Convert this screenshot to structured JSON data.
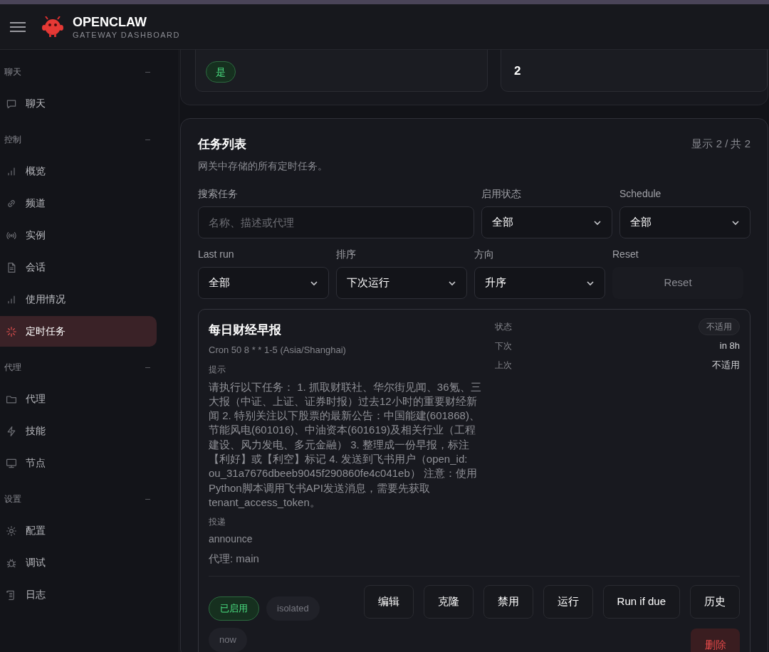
{
  "header": {
    "brand": "OPENCLAW",
    "subtitle": "GATEWAY DASHBOARD"
  },
  "sidebar": {
    "groups": [
      {
        "label": "聊天",
        "expanded": true,
        "items": [
          {
            "label": "聊天",
            "kind": "chat",
            "selected": false
          }
        ]
      },
      {
        "label": "控制",
        "expanded": true,
        "items": [
          {
            "label": "概览",
            "kind": "bars",
            "selected": false
          },
          {
            "label": "频道",
            "kind": "link",
            "selected": false
          },
          {
            "label": "实例",
            "kind": "radio",
            "selected": false
          },
          {
            "label": "会话",
            "kind": "doc",
            "selected": false
          },
          {
            "label": "使用情况",
            "kind": "bars",
            "selected": false
          },
          {
            "label": "定时任务",
            "kind": "spark",
            "selected": true
          }
        ]
      },
      {
        "label": "代理",
        "expanded": true,
        "items": [
          {
            "label": "代理",
            "kind": "folder",
            "selected": false
          },
          {
            "label": "技能",
            "kind": "bolt",
            "selected": false
          },
          {
            "label": "节点",
            "kind": "monitor",
            "selected": false
          }
        ]
      },
      {
        "label": "设置",
        "expanded": true,
        "items": [
          {
            "label": "配置",
            "kind": "gear",
            "selected": false
          },
          {
            "label": "调试",
            "kind": "bug",
            "selected": false
          },
          {
            "label": "日志",
            "kind": "scroll",
            "selected": false
          }
        ]
      }
    ]
  },
  "stats": [
    {
      "kind": "badge",
      "value": "是"
    },
    {
      "kind": "number",
      "value": "2"
    }
  ],
  "task_list": {
    "title": "任务列表",
    "subtitle": "网关中存储的所有定时任务。",
    "count": "显示 2 / 共 2",
    "filters": [
      {
        "kind": "input",
        "label": "搜索任务",
        "placeholder": "名称、描述或代理"
      },
      {
        "kind": "select",
        "label": "启用状态",
        "value": "全部"
      },
      {
        "kind": "select",
        "label": "Schedule",
        "value": "全部"
      },
      {
        "kind": "select",
        "label": "Last run",
        "value": "全部"
      },
      {
        "kind": "select",
        "label": "排序",
        "value": "下次运行"
      },
      {
        "kind": "select",
        "label": "方向",
        "value": "升序"
      },
      {
        "kind": "button",
        "label": "Reset",
        "value": "Reset"
      }
    ],
    "jobs": [
      {
        "name": "每日财经早报",
        "schedule": "Cron 50 8 * * 1-5 (Asia/Shanghai)",
        "prompt_label": "提示",
        "prompt": "请执行以下任务： 1. 抓取财联社、华尔街见闻、36氪、三大报（中证、上证、证券时报）过去12小时的重要财经新闻 2. 特别关注以下股票的最新公告：中国能建(601868)、节能风电(601016)、中油资本(601619)及相关行业（工程建设、风力发电、多元金融） 3. 整理成一份早报，标注【利好】或【利空】标记 4. 发送到飞书用户（open_id: ou_31a7676dbeeb9045f290860fe4c041eb） 注意：使用Python脚本调用飞书API发送消息，需要先获取tenant_access_token。",
        "delivery_label": "投递",
        "delivery": "announce",
        "agent": "代理: main",
        "meta": [
          {
            "label": "状态",
            "value": "不适用",
            "kind": "pill"
          },
          {
            "label": "下次",
            "value": "in 8h",
            "kind": "text"
          },
          {
            "label": "上次",
            "value": "不适用",
            "kind": "text"
          }
        ],
        "tags": [
          {
            "label": "已启用",
            "kind": "enabled"
          },
          {
            "label": "isolated",
            "kind": "plain"
          },
          {
            "label": "now",
            "kind": "plain"
          }
        ],
        "actions": [
          {
            "label": "编辑",
            "kind": "normal"
          },
          {
            "label": "克隆",
            "kind": "normal"
          },
          {
            "label": "禁用",
            "kind": "normal"
          },
          {
            "label": "运行",
            "kind": "normal"
          },
          {
            "label": "Run if due",
            "kind": "normal"
          },
          {
            "label": "历史",
            "kind": "normal"
          },
          {
            "label": "删除",
            "kind": "danger"
          }
        ]
      }
    ]
  }
}
